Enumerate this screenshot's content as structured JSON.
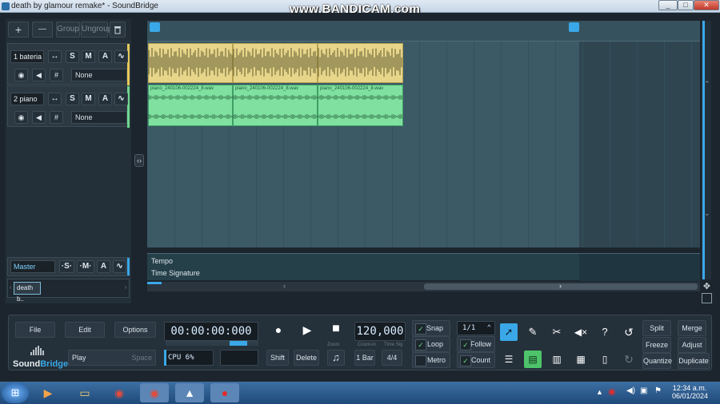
{
  "window": {
    "title": "death by glamour remake* - SoundBridge",
    "min": "_",
    "max": "□",
    "close": "✕"
  },
  "watermark": "www.BANDICAM.com",
  "left_toolbar": {
    "add": "+",
    "remove": "—",
    "group": "Group",
    "ungroup": "Ungroup",
    "delete_icon": "trash"
  },
  "tracks": [
    {
      "name": "1 bateria",
      "solo": "S",
      "mute": "M",
      "arm": "A",
      "input": "None",
      "color": "#e6c95a"
    },
    {
      "name": "2 piano",
      "solo": "S",
      "mute": "M",
      "arm": "A",
      "input": "None",
      "color": "#6fd88f"
    }
  ],
  "master": {
    "name": "Master",
    "solo": "·S·",
    "mute": "·M·",
    "arm": "A"
  },
  "project_tab": "death b..",
  "clips": {
    "drums": [
      "",
      "",
      ""
    ],
    "piano": [
      "piano_240106-002224_8.wav",
      "piano_240106-002224_8.wav",
      "piano_240106-002224_8.wav"
    ]
  },
  "lanes": {
    "tempo": "Tempo",
    "time_signature": "Time Signature"
  },
  "transport": {
    "file": "File",
    "edit": "Edit",
    "options": "Options",
    "time": "00:00:00:000",
    "tempo": "120,000",
    "mode": "Play",
    "space": "Space",
    "cpu": "CPU 6%",
    "shift": "Shift",
    "delete": "Delete",
    "zoom_label": "Zoom",
    "count_in_label": "Count-in",
    "time_sig_label": "Time Sig",
    "count_in": "1 Bar",
    "time_sig": "4/4"
  },
  "options": {
    "snap": "Snap",
    "loop": "Loop",
    "metro": "Metro",
    "follow": "Follow",
    "count": "Count",
    "quant": "1/1"
  },
  "edit_buttons": {
    "split": "Split",
    "merge": "Merge",
    "freeze": "Freeze",
    "adjust": "Adjust",
    "quantize": "Quantize",
    "duplicate": "Duplicate"
  },
  "logo": {
    "part1": "Sound",
    "part2": "Bridge"
  },
  "clock": {
    "time": "12:34 a.m.",
    "date": "06/01/2024"
  },
  "accent": "#3aa8e8"
}
